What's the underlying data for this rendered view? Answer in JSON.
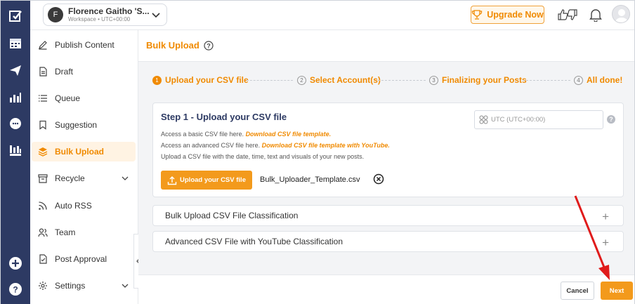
{
  "workspace": {
    "avatar_letter": "F",
    "name": "Florence Gaitho 'S...",
    "sub": "Workspace • UTC+00:00"
  },
  "topbar": {
    "upgrade_label": "Upgrade Now"
  },
  "sidebar": {
    "items": [
      {
        "label": "Publish Content",
        "icon": "pencil-icon"
      },
      {
        "label": "Draft",
        "icon": "document-icon"
      },
      {
        "label": "Queue",
        "icon": "list-icon"
      },
      {
        "label": "Suggestion",
        "icon": "bookmark-icon"
      },
      {
        "label": "Bulk Upload",
        "icon": "layers-icon",
        "active": true
      },
      {
        "label": "Recycle",
        "icon": "archive-icon"
      },
      {
        "label": "Auto RSS",
        "icon": "rss-icon"
      },
      {
        "label": "Team",
        "icon": "team-icon"
      },
      {
        "label": "Post Approval",
        "icon": "approval-icon"
      },
      {
        "label": "Settings",
        "icon": "gear-icon"
      }
    ]
  },
  "page": {
    "title": "Bulk Upload"
  },
  "steps": [
    {
      "num": "1",
      "label": "Upload your CSV file"
    },
    {
      "num": "2",
      "label": "Select Account(s)"
    },
    {
      "num": "3",
      "label": "Finalizing your Posts"
    },
    {
      "num": "4",
      "label": "All done!"
    }
  ],
  "card": {
    "title": "Step 1 - Upload your CSV file",
    "line1_text": "Access a basic CSV file here. ",
    "line1_link": "Download CSV file template.",
    "line2_text": "Access an advanced CSV file here. ",
    "line2_link": "Download CSV file template with YouTube.",
    "line3_text": "Upload a CSV file with the date, time, text and visuals of your new posts.",
    "timezone_placeholder": "UTC (UTC+00:00)",
    "upload_button": "Upload your CSV file",
    "file_name": "Bulk_Uploader_Template.csv"
  },
  "accordions": [
    {
      "label": "Bulk Upload CSV File Classification"
    },
    {
      "label": "Advanced CSV File with YouTube Classification"
    }
  ],
  "footer": {
    "cancel_label": "Cancel",
    "next_label": "Next"
  },
  "colors": {
    "accent": "#f08a00",
    "rail": "#2d3a63",
    "annotation_arrow": "#e01b1b"
  }
}
